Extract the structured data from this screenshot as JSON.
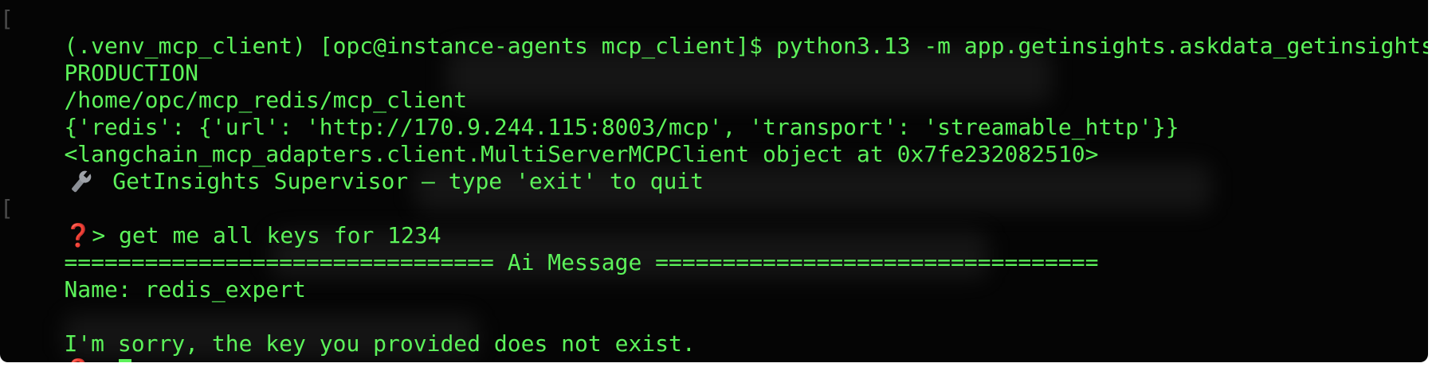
{
  "terminal": {
    "lines": {
      "command": "(.venv_mcp_client) [opc@instance-agents mcp_client]$ python3.13 -m app.getinsights.askdata_getinsights",
      "env": "PRODUCTION",
      "path": "/home/opc/mcp_redis/mcp_client",
      "config": "{'redis': {'url': 'http://170.9.244.115:8003/mcp', 'transport': 'streamable_http'}}",
      "client_obj": "<langchain_mcp_adapters.client.MultiServerMCPClient object at 0x7fe232082510>",
      "banner": " GetInsights Supervisor — type 'exit' to quit",
      "blank1": "",
      "prompt_input": "> get me all keys for 1234",
      "separator": "================================ Ai Message =================================",
      "name": "Name: redis_expert",
      "blank2": "",
      "reply": "I'm sorry, the key you provided does not exist.",
      "prompt_empty": "> "
    },
    "prompt_symbol": "❓",
    "colors": {
      "text": "#5cf25a",
      "background": "#050505",
      "prompt_symbol": "#e0322c"
    },
    "icons": {
      "banner_icon": "wrench-icon"
    }
  }
}
